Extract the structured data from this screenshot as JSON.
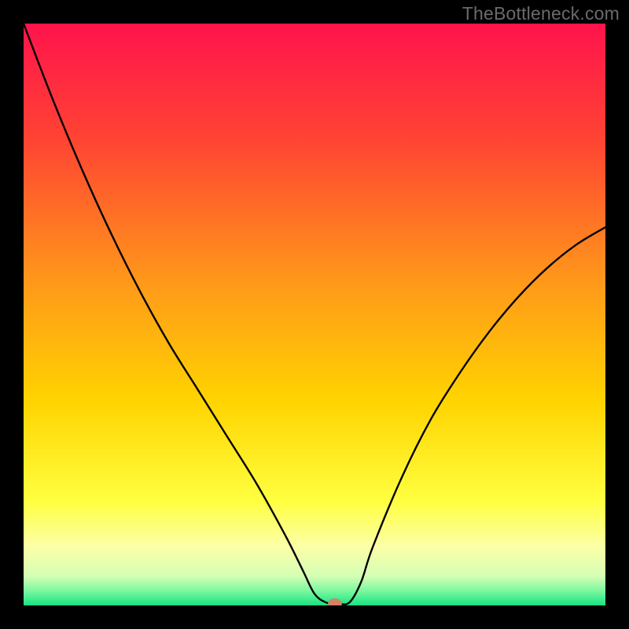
{
  "watermark": "TheBottleneck.com",
  "chart_data": {
    "type": "line",
    "title": "",
    "xlabel": "",
    "ylabel": "",
    "xlim": [
      0,
      100
    ],
    "ylim": [
      0,
      100
    ],
    "grid": false,
    "legend": false,
    "background_gradient": {
      "stops": [
        {
          "pos": 0.0,
          "color": "#ff134c"
        },
        {
          "pos": 0.2,
          "color": "#ff4433"
        },
        {
          "pos": 0.45,
          "color": "#ff9a19"
        },
        {
          "pos": 0.65,
          "color": "#ffd400"
        },
        {
          "pos": 0.82,
          "color": "#ffff40"
        },
        {
          "pos": 0.9,
          "color": "#fbffa8"
        },
        {
          "pos": 0.95,
          "color": "#d4ffb4"
        },
        {
          "pos": 0.975,
          "color": "#7cf7a0"
        },
        {
          "pos": 1.0,
          "color": "#16e481"
        }
      ]
    },
    "series": [
      {
        "name": "bottleneck-curve",
        "color": "#000000",
        "x": [
          0,
          5,
          10,
          15,
          20,
          25,
          30,
          35,
          40,
          45,
          48,
          50,
          52,
          54,
          56,
          58,
          60,
          65,
          70,
          75,
          80,
          85,
          90,
          95,
          100
        ],
        "y": [
          100,
          87,
          75,
          64,
          54,
          45,
          37,
          29,
          21,
          12,
          6,
          2,
          0.5,
          0.3,
          0.5,
          4,
          10,
          22,
          32,
          40,
          47,
          53,
          58,
          62,
          65
        ]
      }
    ],
    "marker": {
      "name": "optimal-point",
      "x": 53.5,
      "y": 0.3,
      "color": "#d68066",
      "rx": 1.2,
      "ry": 0.9
    }
  }
}
